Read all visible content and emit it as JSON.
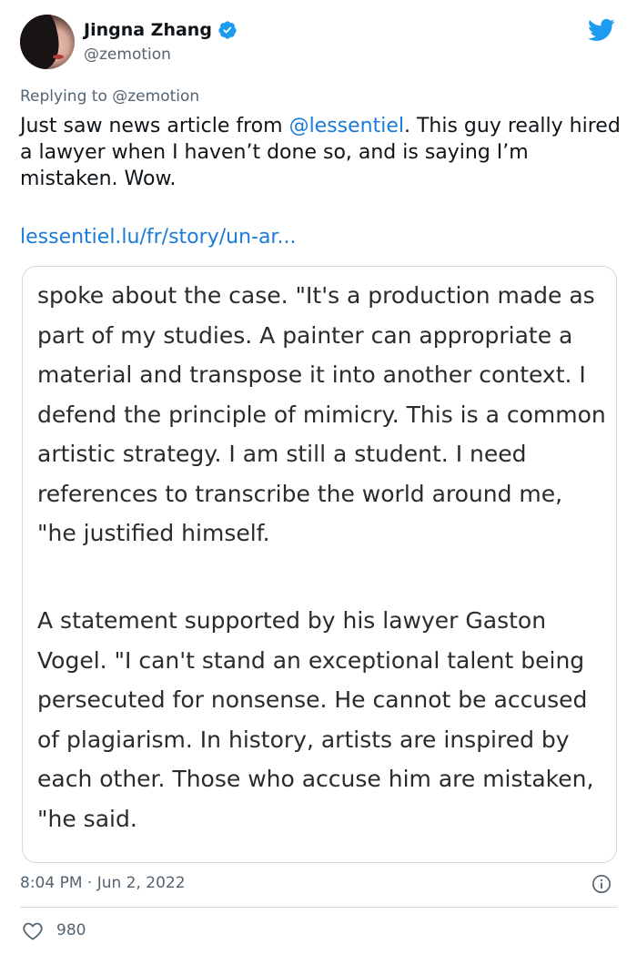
{
  "author": {
    "name": "Jingna Zhang",
    "handle": "@zemotion"
  },
  "reply": {
    "prefix": "Replying to ",
    "to": "@zemotion"
  },
  "tweet": {
    "text_before": "Just saw news article from ",
    "mention": "@lessentiel",
    "text_after": ". This guy really hired a lawyer when I haven’t done so, and is saying I’m mistaken. Wow.",
    "link": "lessentiel.lu/fr/story/un-ar..."
  },
  "article": {
    "paragraph_1": "spoke about the case. \"It's a production made as part of my studies. A painter can appropriate a material and transpose it into another context. I defend the principle of mimicry. This is a common artistic strategy. I am still a student. I need references to transcribe the world around me, \"he justified himself.",
    "paragraph_2": "A statement supported by his lawyer Gaston Vogel. \"I can't stand an exceptional talent being persecuted for nonsense. He cannot be accused of plagiarism. In history, artists are inspired by each other. Those who accuse him are mistaken, \"he said."
  },
  "meta": {
    "timestamp": "8:04 PM · Jun 2, 2022",
    "likes": "980"
  },
  "icons": {
    "brand": "twitter-bird-icon",
    "verified": "verified-badge-icon",
    "info": "info-icon",
    "like": "heart-icon"
  },
  "colors": {
    "link": "#1b7bd9",
    "twitter_blue": "#1d9bf0",
    "secondary_text": "#536471",
    "border": "#cfd9de"
  }
}
